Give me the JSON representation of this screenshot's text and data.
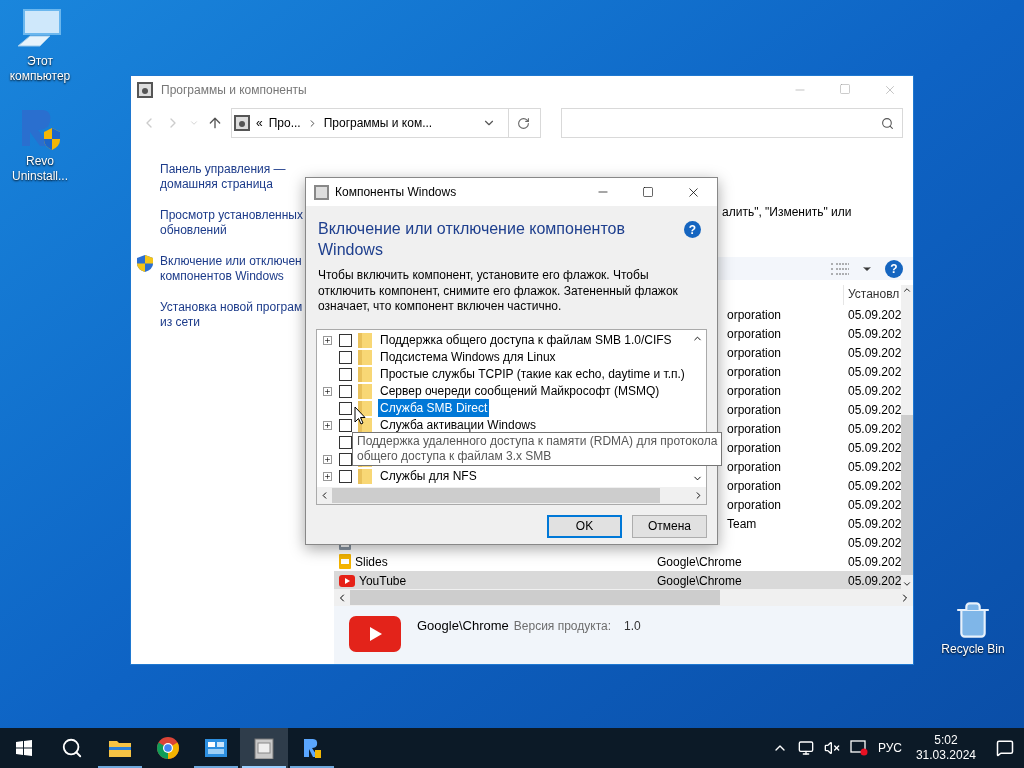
{
  "desktop_icons": [
    {
      "kind": "computer",
      "label": "Этот компьютер"
    },
    {
      "kind": "revo",
      "label": "Revo Uninstall..."
    },
    {
      "kind": "recycle",
      "label": "Recycle Bin"
    }
  ],
  "main_window": {
    "title": "Программы и компоненты",
    "help": "?",
    "breadcrumb_overflow": "«",
    "breadcrumb": [
      "Про...",
      "Программы и ком..."
    ],
    "sidebar": [
      {
        "kind": "link",
        "label": "Панель управления — домашняя страница"
      },
      {
        "kind": "link",
        "label": "Просмотр установленных обновлений"
      },
      {
        "kind": "shield",
        "label": "Включение или отключен компонентов Windows"
      },
      {
        "kind": "link",
        "label": "Установка новой програм из сети"
      }
    ],
    "description": "алить\", \"Изменить\" или",
    "table": {
      "columns": [
        "Установл"
      ],
      "rows": [
        {
          "publisher": "orporation",
          "date": "05.09.202",
          "selected": false
        },
        {
          "publisher": "orporation",
          "date": "05.09.202",
          "selected": false
        },
        {
          "publisher": "orporation",
          "date": "05.09.202",
          "selected": false
        },
        {
          "publisher": "orporation",
          "date": "05.09.202",
          "selected": false
        },
        {
          "publisher": "orporation",
          "date": "05.09.202",
          "selected": false
        },
        {
          "publisher": "orporation",
          "date": "05.09.202",
          "selected": false
        },
        {
          "publisher": "orporation",
          "date": "05.09.202",
          "selected": false
        },
        {
          "publisher": "orporation",
          "date": "05.09.202",
          "selected": false
        },
        {
          "publisher": "orporation",
          "date": "05.09.202",
          "selected": false
        },
        {
          "publisher": "orporation",
          "date": "05.09.202",
          "selected": false
        },
        {
          "publisher": "orporation",
          "date": "05.09.202",
          "selected": false
        },
        {
          "publisher": "Team",
          "date": "05.09.202",
          "selected": false
        },
        {
          "kind": "sheets",
          "date": "05.09.202",
          "selected": false
        },
        {
          "kind": "slides",
          "name": "Slides",
          "publisher": "Google\\Chrome",
          "date": "05.09.202",
          "selected": false
        },
        {
          "kind": "youtube",
          "name": "YouTube",
          "publisher": "Google\\Chrome",
          "date": "05.09.202",
          "selected": true
        }
      ]
    },
    "details": {
      "publisher": "Google\\Chrome",
      "version_label": "Версия продукта:",
      "version": "1.0"
    }
  },
  "dialog": {
    "title": "Компоненты Windows",
    "help": "?",
    "heading": "Включение или отключение компонентов Windows",
    "text": "Чтобы включить компонент, установите его флажок. Чтобы отключить компонент, снимите его флажок. Затененный флажок означает, что компонент включен частично.",
    "features": [
      {
        "expandable": true,
        "checked": false,
        "selected": false,
        "label": "Поддержка общего доступа к файлам SMB 1.0/CIFS"
      },
      {
        "expandable": false,
        "checked": false,
        "selected": false,
        "label": "Подсистема Windows для Linux"
      },
      {
        "expandable": false,
        "checked": false,
        "selected": false,
        "label": "Простые службы TCPIP (такие как echo, daytime и т.п.)"
      },
      {
        "expandable": true,
        "checked": false,
        "selected": false,
        "label": "Сервер очереди сообщений Майкрософт (MSMQ)"
      },
      {
        "expandable": false,
        "checked": false,
        "selected": true,
        "label": "Служба SMB Direct"
      },
      {
        "expandable": true,
        "checked": false,
        "selected": false,
        "label": "Служба активации Windows"
      },
      {
        "expandable": false,
        "checked": false
      },
      {
        "expandable": true,
        "checked": false
      },
      {
        "expandable": true,
        "checked": false,
        "selected": false,
        "label": "Службы для NFS"
      }
    ],
    "tooltip": "Поддержка удаленного доступа к памяти (RDMA) для протокола\nобщего доступа к файлам 3.x SMB",
    "buttons": [
      {
        "label": "OK",
        "default": true
      },
      {
        "label": "Отмена",
        "default": false
      }
    ]
  },
  "taskbar": {
    "apps": [
      {
        "kind": "start",
        "running": false,
        "active": false
      },
      {
        "kind": "search",
        "running": false,
        "active": false
      },
      {
        "kind": "explorer",
        "running": true,
        "active": false
      },
      {
        "kind": "chrome",
        "running": false,
        "active": false
      },
      {
        "kind": "control",
        "running": true,
        "active": false
      },
      {
        "kind": "programs",
        "running": true,
        "active": true
      },
      {
        "kind": "revo",
        "running": true,
        "active": false
      }
    ],
    "language": "РУС",
    "time": "5:02",
    "date": "31.03.2024"
  }
}
